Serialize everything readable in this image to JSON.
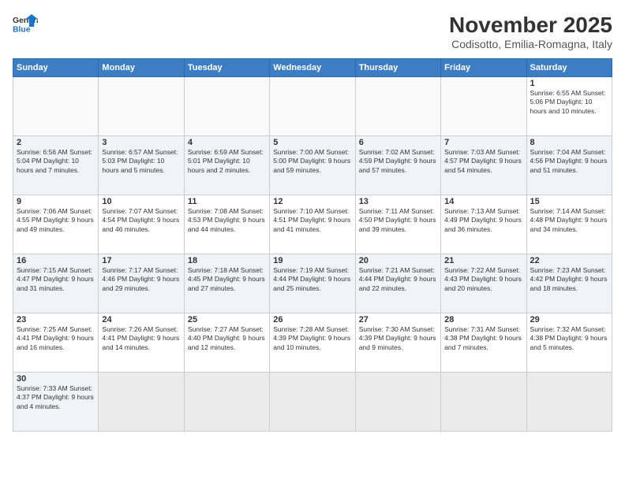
{
  "header": {
    "logo_general": "General",
    "logo_blue": "Blue",
    "title": "November 2025",
    "location": "Codisotto, Emilia-Romagna, Italy"
  },
  "days_of_week": [
    "Sunday",
    "Monday",
    "Tuesday",
    "Wednesday",
    "Thursday",
    "Friday",
    "Saturday"
  ],
  "weeks": [
    {
      "row_alt": false,
      "days": [
        {
          "num": "",
          "info": ""
        },
        {
          "num": "",
          "info": ""
        },
        {
          "num": "",
          "info": ""
        },
        {
          "num": "",
          "info": ""
        },
        {
          "num": "",
          "info": ""
        },
        {
          "num": "",
          "info": ""
        },
        {
          "num": "1",
          "info": "Sunrise: 6:55 AM\nSunset: 5:06 PM\nDaylight: 10 hours\nand 10 minutes."
        }
      ]
    },
    {
      "row_alt": true,
      "days": [
        {
          "num": "2",
          "info": "Sunrise: 6:56 AM\nSunset: 5:04 PM\nDaylight: 10 hours\nand 7 minutes."
        },
        {
          "num": "3",
          "info": "Sunrise: 6:57 AM\nSunset: 5:03 PM\nDaylight: 10 hours\nand 5 minutes."
        },
        {
          "num": "4",
          "info": "Sunrise: 6:59 AM\nSunset: 5:01 PM\nDaylight: 10 hours\nand 2 minutes."
        },
        {
          "num": "5",
          "info": "Sunrise: 7:00 AM\nSunset: 5:00 PM\nDaylight: 9 hours\nand 59 minutes."
        },
        {
          "num": "6",
          "info": "Sunrise: 7:02 AM\nSunset: 4:59 PM\nDaylight: 9 hours\nand 57 minutes."
        },
        {
          "num": "7",
          "info": "Sunrise: 7:03 AM\nSunset: 4:57 PM\nDaylight: 9 hours\nand 54 minutes."
        },
        {
          "num": "8",
          "info": "Sunrise: 7:04 AM\nSunset: 4:56 PM\nDaylight: 9 hours\nand 51 minutes."
        }
      ]
    },
    {
      "row_alt": false,
      "days": [
        {
          "num": "9",
          "info": "Sunrise: 7:06 AM\nSunset: 4:55 PM\nDaylight: 9 hours\nand 49 minutes."
        },
        {
          "num": "10",
          "info": "Sunrise: 7:07 AM\nSunset: 4:54 PM\nDaylight: 9 hours\nand 46 minutes."
        },
        {
          "num": "11",
          "info": "Sunrise: 7:08 AM\nSunset: 4:53 PM\nDaylight: 9 hours\nand 44 minutes."
        },
        {
          "num": "12",
          "info": "Sunrise: 7:10 AM\nSunset: 4:51 PM\nDaylight: 9 hours\nand 41 minutes."
        },
        {
          "num": "13",
          "info": "Sunrise: 7:11 AM\nSunset: 4:50 PM\nDaylight: 9 hours\nand 39 minutes."
        },
        {
          "num": "14",
          "info": "Sunrise: 7:13 AM\nSunset: 4:49 PM\nDaylight: 9 hours\nand 36 minutes."
        },
        {
          "num": "15",
          "info": "Sunrise: 7:14 AM\nSunset: 4:48 PM\nDaylight: 9 hours\nand 34 minutes."
        }
      ]
    },
    {
      "row_alt": true,
      "days": [
        {
          "num": "16",
          "info": "Sunrise: 7:15 AM\nSunset: 4:47 PM\nDaylight: 9 hours\nand 31 minutes."
        },
        {
          "num": "17",
          "info": "Sunrise: 7:17 AM\nSunset: 4:46 PM\nDaylight: 9 hours\nand 29 minutes."
        },
        {
          "num": "18",
          "info": "Sunrise: 7:18 AM\nSunset: 4:45 PM\nDaylight: 9 hours\nand 27 minutes."
        },
        {
          "num": "19",
          "info": "Sunrise: 7:19 AM\nSunset: 4:44 PM\nDaylight: 9 hours\nand 25 minutes."
        },
        {
          "num": "20",
          "info": "Sunrise: 7:21 AM\nSunset: 4:44 PM\nDaylight: 9 hours\nand 22 minutes."
        },
        {
          "num": "21",
          "info": "Sunrise: 7:22 AM\nSunset: 4:43 PM\nDaylight: 9 hours\nand 20 minutes."
        },
        {
          "num": "22",
          "info": "Sunrise: 7:23 AM\nSunset: 4:42 PM\nDaylight: 9 hours\nand 18 minutes."
        }
      ]
    },
    {
      "row_alt": false,
      "days": [
        {
          "num": "23",
          "info": "Sunrise: 7:25 AM\nSunset: 4:41 PM\nDaylight: 9 hours\nand 16 minutes."
        },
        {
          "num": "24",
          "info": "Sunrise: 7:26 AM\nSunset: 4:41 PM\nDaylight: 9 hours\nand 14 minutes."
        },
        {
          "num": "25",
          "info": "Sunrise: 7:27 AM\nSunset: 4:40 PM\nDaylight: 9 hours\nand 12 minutes."
        },
        {
          "num": "26",
          "info": "Sunrise: 7:28 AM\nSunset: 4:39 PM\nDaylight: 9 hours\nand 10 minutes."
        },
        {
          "num": "27",
          "info": "Sunrise: 7:30 AM\nSunset: 4:39 PM\nDaylight: 9 hours\nand 9 minutes."
        },
        {
          "num": "28",
          "info": "Sunrise: 7:31 AM\nSunset: 4:38 PM\nDaylight: 9 hours\nand 7 minutes."
        },
        {
          "num": "29",
          "info": "Sunrise: 7:32 AM\nSunset: 4:38 PM\nDaylight: 9 hours\nand 5 minutes."
        }
      ]
    },
    {
      "row_alt": true,
      "days": [
        {
          "num": "30",
          "info": "Sunrise: 7:33 AM\nSunset: 4:37 PM\nDaylight: 9 hours\nand 4 minutes."
        },
        {
          "num": "",
          "info": ""
        },
        {
          "num": "",
          "info": ""
        },
        {
          "num": "",
          "info": ""
        },
        {
          "num": "",
          "info": ""
        },
        {
          "num": "",
          "info": ""
        },
        {
          "num": "",
          "info": ""
        }
      ]
    }
  ]
}
